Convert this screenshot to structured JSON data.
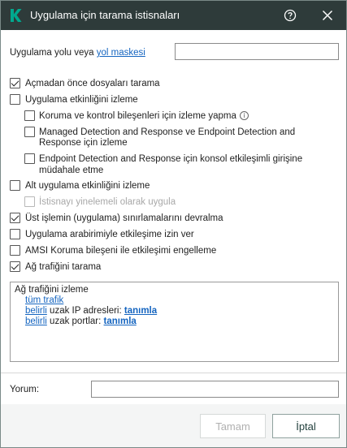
{
  "window": {
    "title": "Uygulama için tarama istisnaları"
  },
  "path": {
    "label_prefix": "Uygulama yolu veya",
    "label_link": "yol maskesi",
    "value": ""
  },
  "options": [
    {
      "label": "Açmadan önce dosyaları tarama",
      "checked": true
    },
    {
      "label": "Uygulama etkinliğini izleme",
      "checked": false
    },
    {
      "label": "Koruma ve kontrol bileşenleri için izleme yapma",
      "checked": false
    },
    {
      "label": "Managed Detection and Response ve Endpoint Detection and",
      "label2": "Response için izleme",
      "checked": false
    },
    {
      "label": "Endpoint Detection and Response için konsol etkileşimli girişine",
      "label2": "müdahale etme",
      "checked": false
    },
    {
      "label": "Alt uygulama etkinliğini izleme",
      "checked": false
    },
    {
      "label": "İstisnayı yinelemeli olarak uygula",
      "checked": false,
      "disabled": true
    },
    {
      "label": "Üst işlemin (uygulama) sınırlamalarını devralma",
      "checked": true
    },
    {
      "label": "Uygulama arabirimiyle etkileşime izin ver",
      "checked": false
    },
    {
      "label": "AMSI Koruma bileşeni ile etkileşimi engelleme",
      "checked": false
    },
    {
      "label": "Ağ trafiğini tarama",
      "checked": true
    }
  ],
  "network": {
    "heading": "Ağ trafiğini izleme",
    "all_traffic": "tüm trafik",
    "specific1": "belirli",
    "ip_text": "uzak IP adresleri:",
    "define1": "tanımla",
    "specific2": "belirli",
    "ports_text": "uzak portlar:",
    "define2": "tanımla"
  },
  "comment": {
    "label": "Yorum:",
    "value": ""
  },
  "buttons": {
    "ok": "Tamam",
    "cancel": "İptal"
  },
  "colors": {
    "titlebar": "#2e3b3a",
    "link": "#1565c0",
    "brand": "#00a88e"
  }
}
